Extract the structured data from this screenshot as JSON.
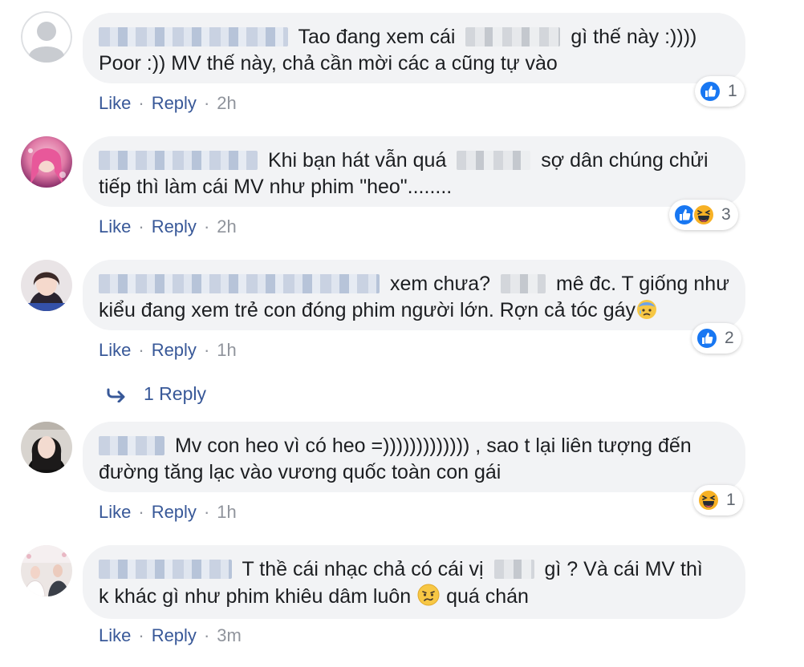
{
  "actions": {
    "like": "Like",
    "reply": "Reply",
    "separator": "·"
  },
  "comments": [
    {
      "line1": "Tao đang xem cái",
      "line1b": "gì thế này :))))",
      "line2": "Poor :)) MV thế này, chả cần mời các a cũng tự vào",
      "time": "2h",
      "reaction_count": "1"
    },
    {
      "line1": "Khi bạn hát vẫn quá",
      "line1b": "sợ dân chúng chửi",
      "line2": "tiếp thì làm cái MV như phim \"heo\"........",
      "time": "2h",
      "reaction_count": "3"
    },
    {
      "line1": "xem chưa?",
      "line1b": "mê đc. T giống như",
      "line2": "kiểu đang xem trẻ con đóng phim người lớn. Rợn cả tóc gáy",
      "time": "1h",
      "reaction_count": "2",
      "replies_label": "1 Reply"
    },
    {
      "line1": "Mv con heo vì có heo =))))))))))))) , sao t lại liên tượng đến",
      "line2": "đường tăng lạc vào vương quốc toàn con gái",
      "time": "1h",
      "reaction_count": "1"
    },
    {
      "line1": "T thề cái nhạc chả có cái vị",
      "line1b": "gì ? Và cái MV thì",
      "line2": "k khác gì như phim khiêu dâm luôn",
      "line2b": "quá chán",
      "time": "3m"
    }
  ],
  "colors": {
    "bubble": "#f2f3f5",
    "link": "#385898",
    "like_blue": "#1877f2",
    "meta": "#90949c"
  },
  "icons": [
    "like-icon",
    "haha-icon",
    "sweat-emoji-icon",
    "confused-emoji-icon",
    "reply-arrow-icon",
    "avatar-placeholder-icon"
  ]
}
